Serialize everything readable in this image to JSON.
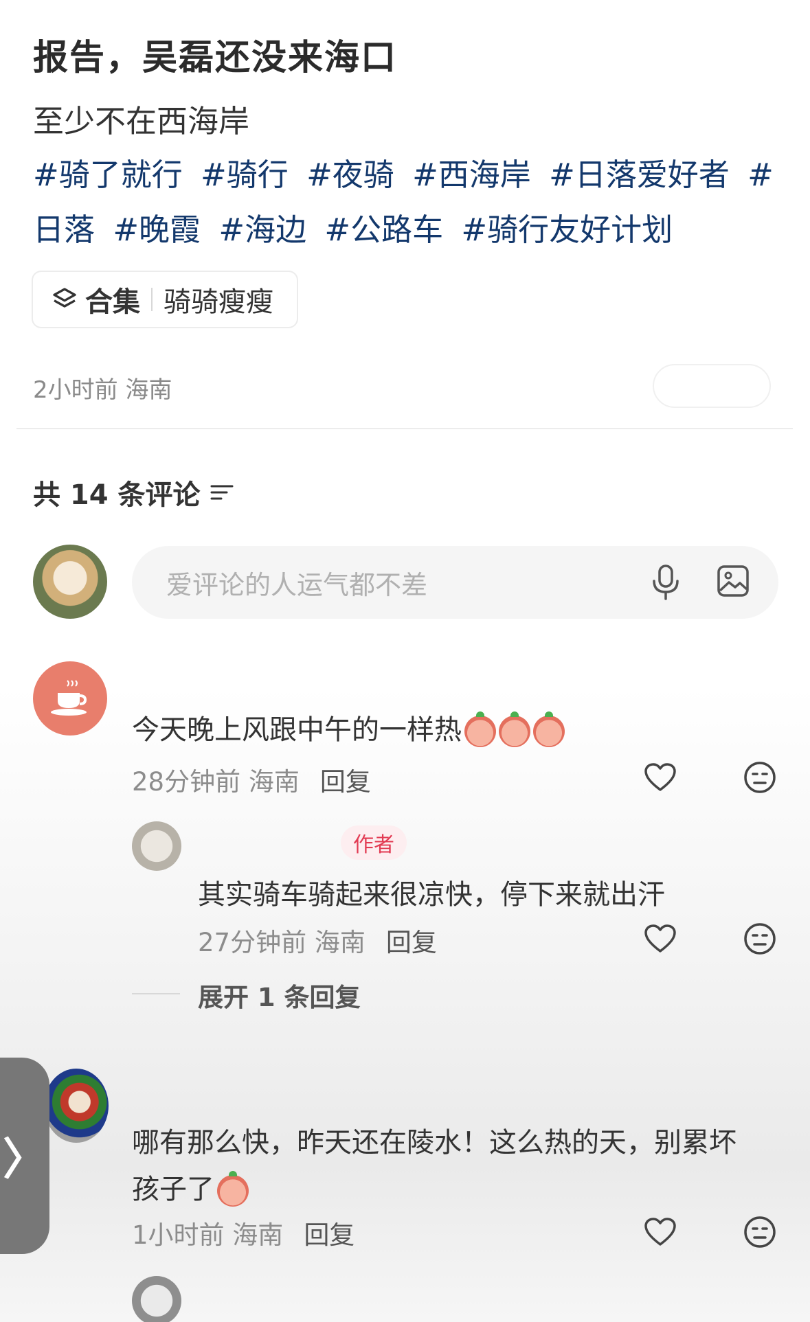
{
  "post": {
    "title": "报告，吴磊还没来海口",
    "subtitle": "至少不在西海岸",
    "tags": [
      "#骑了就行",
      "#骑行",
      "#夜骑",
      "#西海岸",
      "#日落爱好者",
      "#日落",
      "#晚霞",
      "#海边",
      "#公路车",
      "#骑行友好计划"
    ],
    "collection_label": "合集",
    "collection_name": "骑骑瘦瘦",
    "meta": "2小时前 海南"
  },
  "comments_header": {
    "count_text": "共 14 条评论",
    "sort_icon": "filter-lines-icon"
  },
  "comment_input": {
    "placeholder": "爱评论的人运气都不差",
    "mic_icon": "microphone-icon",
    "image_icon": "image-icon"
  },
  "comments": [
    {
      "text": "今天晚上风跟中午的一样热",
      "meta": "28分钟前 海南",
      "reply_label": "回复",
      "emoji_icon": "crying-peach-emoji-icon"
    },
    {
      "badge": "作者",
      "text": "其实骑车骑起来很凉快，停下来就出汗",
      "meta": "27分钟前 海南",
      "reply_label": "回复"
    },
    {
      "text_line1": "哪有那么快，昨天还在陵水！这么热的天，别累坏",
      "text_line2": "孩子了",
      "meta": "1小时前 海南",
      "reply_label": "回复",
      "emoji_icon": "peach-emoji-icon"
    }
  ],
  "expand_replies": "展开 1 条回复",
  "side_tab_glyph": "〉",
  "colors": {
    "tag": "#13386c",
    "author_badge_bg": "#fdeef0",
    "author_badge_text": "#e23a52",
    "avatar_coffee": "#e87e6c"
  }
}
